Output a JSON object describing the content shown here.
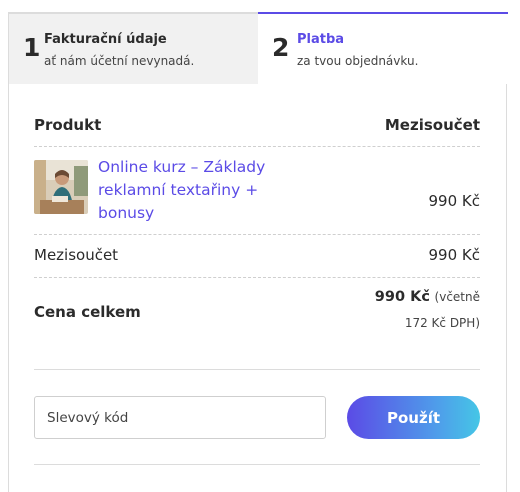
{
  "steps": [
    {
      "number": "1",
      "title": "Fakturační údaje",
      "subtitle": "ať nám účetní nevynadá."
    },
    {
      "number": "2",
      "title": "Platba",
      "subtitle": "za tvou objednávku."
    }
  ],
  "table": {
    "header_product": "Produkt",
    "header_subtotal": "Mezisoučet",
    "product": {
      "name": "Online kurz – Základy reklamní textařiny + bonusy",
      "price": "990 Kč"
    },
    "subtotal_label": "Mezisoučet",
    "subtotal_value": "990 Kč",
    "total_label": "Cena celkem",
    "total_value": "990 Kč",
    "total_incl_prefix": "(včetně",
    "total_tax": "172 Kč DPH)"
  },
  "coupon": {
    "placeholder": "Slevový kód",
    "button_label": "Použít"
  },
  "colors": {
    "accent": "#5b4be6",
    "button_gradient_end": "#45c6e6"
  }
}
